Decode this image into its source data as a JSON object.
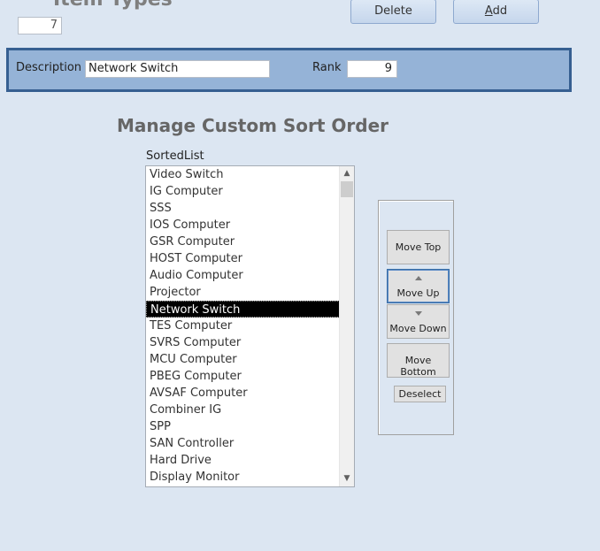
{
  "header": {
    "title": "Item Types",
    "id_value": "7",
    "delete_label": "Delete",
    "add_label_accel": "A",
    "add_label_rest": "dd"
  },
  "detail": {
    "description_label": "Description",
    "description_value": "Network Switch",
    "rank_label": "Rank",
    "rank_value": "9"
  },
  "sort": {
    "section_title": "Manage Custom Sort Order",
    "list_label": "SortedList",
    "items": [
      "Video Switch",
      "IG Computer",
      "SSS",
      "IOS Computer",
      "GSR Computer",
      "HOST Computer",
      "Audio Computer",
      "Projector",
      "Network Switch",
      "TES Computer",
      "SVRS Computer",
      "MCU Computer",
      "PBEG Computer",
      "AVSAF Computer",
      "Combiner IG",
      "SPP",
      "SAN Controller",
      "Hard Drive",
      "Display Monitor"
    ],
    "selected_item": "Network Switch"
  },
  "buttons": {
    "move_top": "Move Top",
    "move_up": "Move Up",
    "move_down": "Move Down",
    "move_bottom": "Move Bottom",
    "deselect": "Deselect"
  },
  "colors": {
    "background": "#dce6f2",
    "detail_band": "#95b3d7",
    "detail_border": "#365f91",
    "selection": "#000000"
  }
}
